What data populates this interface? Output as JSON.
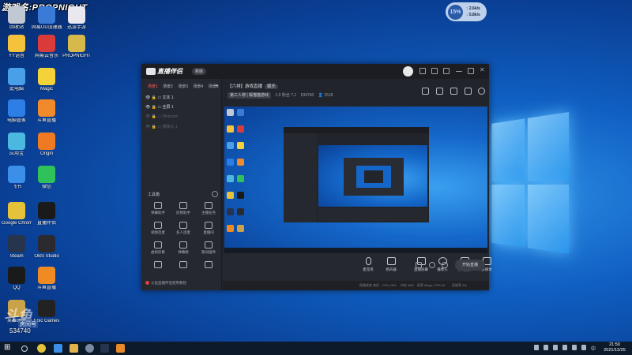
{
  "watermark": "游戏名:PROPNIGHT",
  "net_widget": {
    "percent": "15%",
    "up": "2.6k/s",
    "down": "5.8k/s"
  },
  "desktop_icons": [
    {
      "label": "回收站",
      "color": "#c0c8d4"
    },
    {
      "label": "网易UU加速器",
      "color": "#3b7bd8"
    },
    {
      "label": "迅游手游",
      "color": "#e8e8ee"
    },
    {
      "label": "YY语音",
      "color": "#f6c23b"
    },
    {
      "label": "网易云音乐",
      "color": "#d93a3a"
    },
    {
      "label": "PROPNIGHT",
      "color": "#d6b94a"
    },
    {
      "label": "此电脑",
      "color": "#4aa0e8"
    },
    {
      "label": "Magic",
      "color": "#f4d23a"
    },
    {
      "label": "电脑管家",
      "color": "#2d7ee6"
    },
    {
      "label": "斗鱼直播",
      "color": "#f18a2a"
    },
    {
      "label": "应用宝",
      "color": "#4bb8e0"
    },
    {
      "label": "Origin",
      "color": "#f07a22"
    },
    {
      "label": "飞书",
      "color": "#3c8fe8"
    },
    {
      "label": "微信",
      "color": "#2fc25a"
    },
    {
      "label": "Google Chrome",
      "color": "#e6c23a"
    },
    {
      "label": "直播伴侣",
      "color": "#1a1a1a"
    },
    {
      "label": "Steam",
      "color": "#26354d"
    },
    {
      "label": "OBS Studio",
      "color": "#2a2a30"
    },
    {
      "label": "QQ",
      "color": "#1a1a1a"
    },
    {
      "label": "斗鱼直播",
      "color": "#f08a22"
    },
    {
      "label": "英雄联盟",
      "color": "#caa24a"
    },
    {
      "label": "Epic Games",
      "color": "#222"
    }
  ],
  "app": {
    "brand": "直播伴侣",
    "version": "新版",
    "scene_tabs": [
      "场景1",
      "场景2",
      "场景3",
      "场景4",
      "场景5"
    ],
    "layers": [
      {
        "name": "文本 1",
        "dim": false
      },
      {
        "name": "全屏 1",
        "dim": false
      },
      {
        "name": "Webcam",
        "dim": true
      },
      {
        "name": "摄像头 1",
        "dim": true
      }
    ],
    "tools_title": "工具箱",
    "tools": [
      "弹幕助手",
      "房管助手",
      "主播任务",
      "视频连麦",
      "多人连麦",
      "直播间",
      "虚拟形象",
      "弹幕姬",
      "歌词插件",
      "",
      "",
      ""
    ],
    "notice": "斗鱼直播伴侣使用教程",
    "room_title": "【六排】游戏直播",
    "room_tag": "娱乐",
    "room_category": "第三人称 | 躲猫猫游戏",
    "room_id": "1.0 粉丝 7.1",
    "room_num": "534740",
    "room_viewers": "1519",
    "controls": [
      "直播屏幕",
      "摄像头",
      "手机投屏",
      "多媒体",
      "麦克风",
      "扬声器"
    ],
    "start_label": "开始直播",
    "status": [
      "网络状态 良好",
      "CPU 25%",
      "内存 38%",
      "码率 0kbps",
      "FPS 30",
      "丢帧率 0%"
    ]
  },
  "overlay": {
    "logo": "斗鱼",
    "room_label": "房间号",
    "room_number": "534740"
  },
  "taskbar": {
    "time": "21:50",
    "date": "2021/12/25"
  }
}
